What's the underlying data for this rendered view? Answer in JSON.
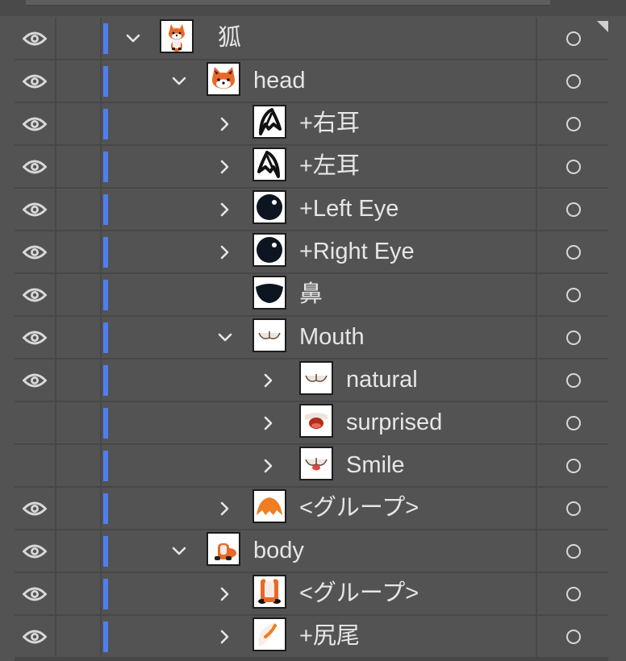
{
  "colors": {
    "panel_bg": "#535353",
    "row_border": "#474747",
    "layer_color": "#4f7ef0",
    "text": "#e6e6e6",
    "icon": "#d8d8d8"
  },
  "icons": {
    "visibility": "eye-icon",
    "expanded": "chevron-down-icon",
    "collapsed": "chevron-right-icon",
    "target": "target-circle-icon"
  },
  "layers": [
    {
      "label": "狐",
      "depth": 0,
      "expand": "open",
      "visible": true,
      "thumb": "fox"
    },
    {
      "label": "head",
      "depth": 1,
      "expand": "open",
      "visible": true,
      "thumb": "fox-head"
    },
    {
      "label": "+右耳",
      "depth": 2,
      "expand": "closed",
      "visible": true,
      "thumb": "ear-right"
    },
    {
      "label": "+左耳",
      "depth": 2,
      "expand": "closed",
      "visible": true,
      "thumb": "ear-left"
    },
    {
      "label": "+Left Eye",
      "depth": 2,
      "expand": "closed",
      "visible": true,
      "thumb": "eye"
    },
    {
      "label": "+Right Eye",
      "depth": 2,
      "expand": "closed",
      "visible": true,
      "thumb": "eye"
    },
    {
      "label": "鼻",
      "depth": 2,
      "expand": "none",
      "visible": true,
      "thumb": "nose"
    },
    {
      "label": "Mouth",
      "depth": 2,
      "expand": "open",
      "visible": true,
      "thumb": "mouth"
    },
    {
      "label": "natural",
      "depth": 3,
      "expand": "closed",
      "visible": true,
      "thumb": "mouth"
    },
    {
      "label": "surprised",
      "depth": 3,
      "expand": "closed",
      "visible": false,
      "thumb": "mouth-surprised"
    },
    {
      "label": "Smile",
      "depth": 3,
      "expand": "closed",
      "visible": false,
      "thumb": "mouth-smile"
    },
    {
      "label": "<グループ>",
      "depth": 2,
      "expand": "closed",
      "visible": true,
      "thumb": "fur"
    },
    {
      "label": "body",
      "depth": 1,
      "expand": "open",
      "visible": true,
      "thumb": "body"
    },
    {
      "label": "<グループ>",
      "depth": 2,
      "expand": "closed",
      "visible": true,
      "thumb": "body-group"
    },
    {
      "label": "+尻尾",
      "depth": 2,
      "expand": "closed",
      "visible": true,
      "thumb": "tail"
    }
  ]
}
